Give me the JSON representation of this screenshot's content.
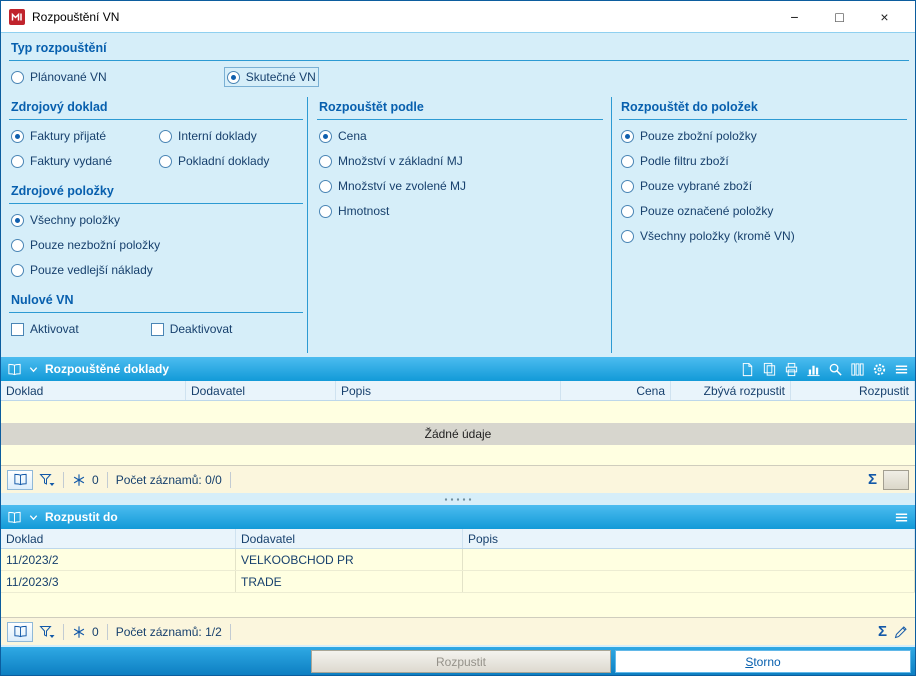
{
  "window": {
    "title": "Rozpouštění VN",
    "controls": {
      "minimize": "−",
      "maximize": "□",
      "close": "×"
    }
  },
  "sections": {
    "typ": {
      "heading": "Typ rozpouštění",
      "options": [
        {
          "label": "Plánované VN",
          "selected": false
        },
        {
          "label": "Skutečné VN",
          "selected": true,
          "focus": true
        }
      ]
    },
    "zdrojovy_doklad": {
      "heading": "Zdrojový doklad",
      "options": [
        {
          "label": "Faktury přijaté",
          "selected": true
        },
        {
          "label": "Interní doklady",
          "selected": false
        },
        {
          "label": "Faktury vydané",
          "selected": false
        },
        {
          "label": "Pokladní doklady",
          "selected": false
        }
      ]
    },
    "zdrojove_polozky": {
      "heading": "Zdrojové položky",
      "options": [
        {
          "label": "Všechny položky",
          "selected": true
        },
        {
          "label": "Pouze nezbožní položky",
          "selected": false
        },
        {
          "label": "Pouze vedlejší náklady",
          "selected": false
        }
      ]
    },
    "nulove_vn": {
      "heading": "Nulové VN",
      "checkboxes": [
        {
          "label": "Aktivovat",
          "checked": false
        },
        {
          "label": "Deaktivovat",
          "checked": false
        }
      ]
    },
    "rozpoustet_podle": {
      "heading": "Rozpouštět podle",
      "options": [
        {
          "label": "Cena",
          "selected": true
        },
        {
          "label": "Množství v základní MJ",
          "selected": false
        },
        {
          "label": "Množství ve zvolené MJ",
          "selected": false
        },
        {
          "label": "Hmotnost",
          "selected": false
        }
      ]
    },
    "rozpoustet_do": {
      "heading": "Rozpouštět do položek",
      "options": [
        {
          "label": "Pouze zbožní položky",
          "selected": true
        },
        {
          "label": "Podle filtru zboží",
          "selected": false
        },
        {
          "label": "Pouze vybrané zboží",
          "selected": false
        },
        {
          "label": "Pouze označené položky",
          "selected": false
        },
        {
          "label": "Všechny položky (kromě VN)",
          "selected": false
        }
      ]
    }
  },
  "grid1": {
    "title": "Rozpouštěné doklady",
    "columns": [
      "Doklad",
      "Dodavatel",
      "Popis",
      "Cena",
      "Zbývá rozpustit",
      "Rozpustit"
    ],
    "empty_text": "Žádné údaje",
    "status": {
      "count_badge": "0",
      "records": "Počet záznamů: 0/0"
    }
  },
  "grid2": {
    "title": "Rozpustit do",
    "columns": [
      "Doklad",
      "Dodavatel",
      "Popis"
    ],
    "rows": [
      {
        "doklad": "11/2023/2",
        "dodavatel": "VELKOOBCHOD PR",
        "popis": ""
      },
      {
        "doklad": "11/2023/3",
        "dodavatel": "TRADE",
        "popis": ""
      }
    ],
    "status": {
      "count_badge": "0",
      "records": "Počet záznamů: 1/2"
    }
  },
  "footer": {
    "rozpustit_label": "Rozpustit",
    "storno_label": "Storno"
  },
  "icons": {
    "sum": "Σ"
  }
}
